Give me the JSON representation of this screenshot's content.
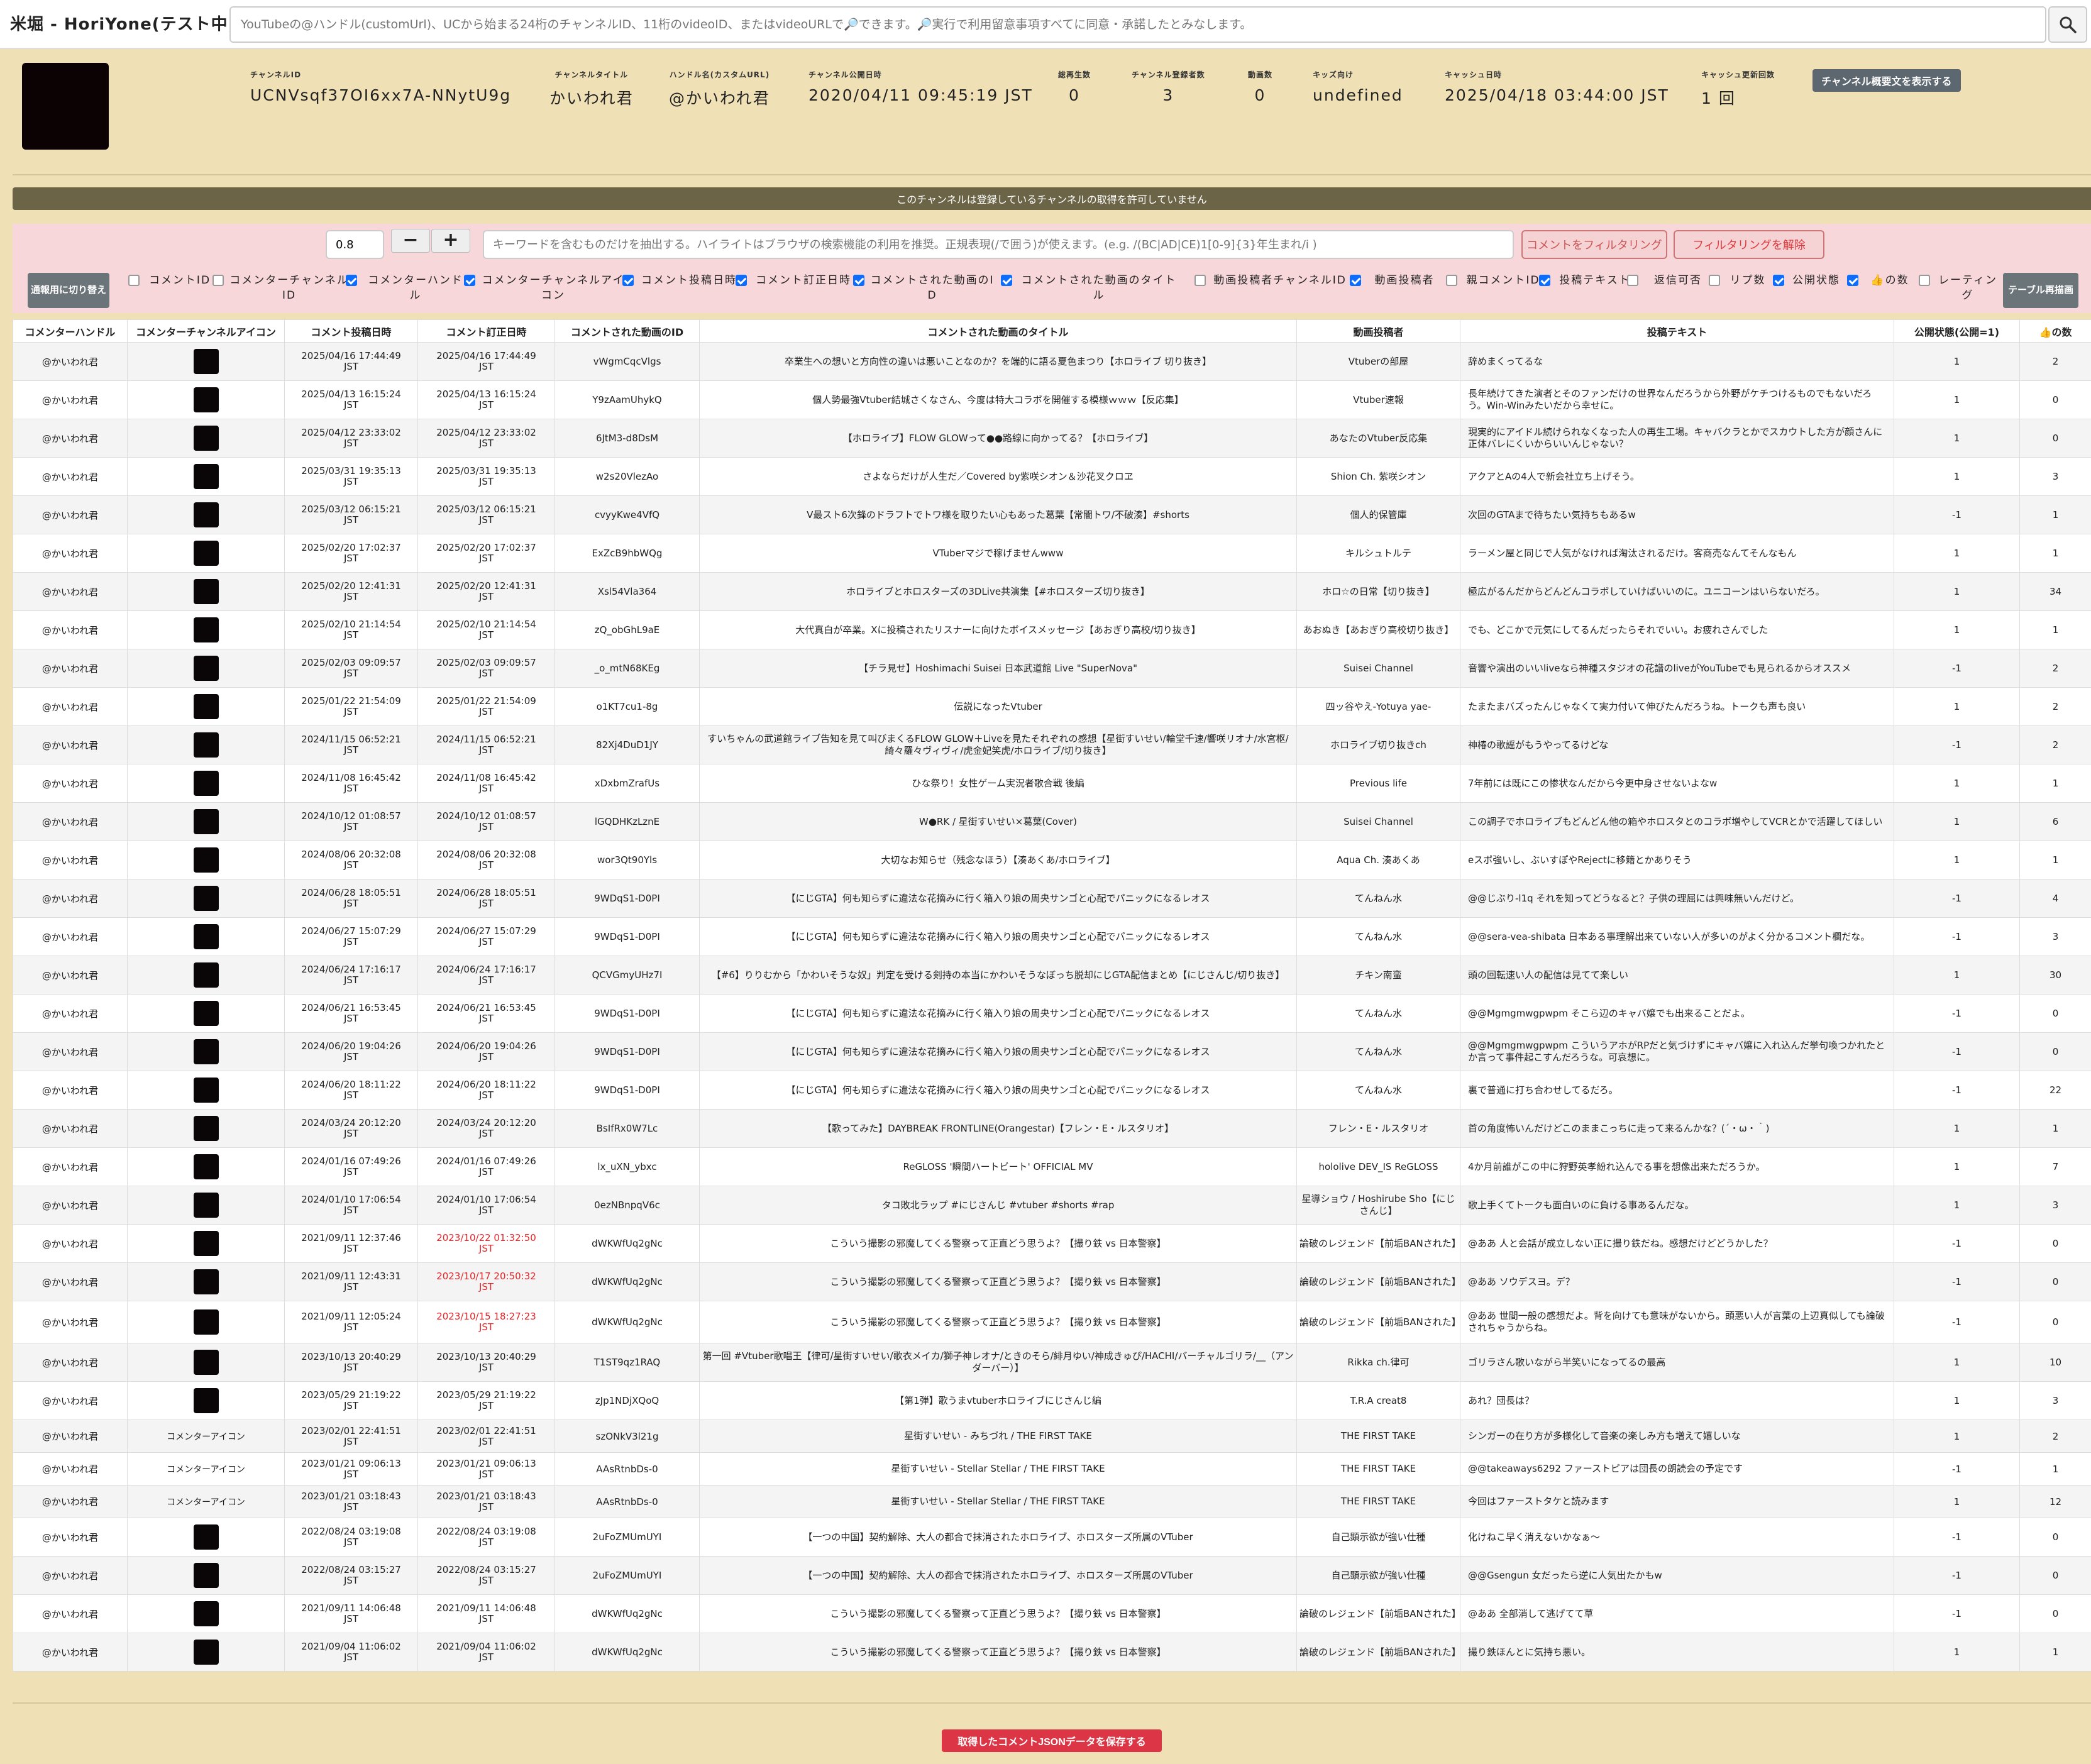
{
  "header": {
    "title": "米堀 - HoriYone(テスト中)",
    "search_placeholder": "YouTubeの@ハンドル(customUrl)、UCから始まる24桁のチャンネルID、11桁のvideoID、またはvideoURLで🔎できます。🔎実行で利用留意事項すべてに同意・承諾したとみなします。",
    "search_icon": "search-icon"
  },
  "channel": {
    "fields": [
      {
        "label": "チャンネルID",
        "value": "UCNVsqf37OI6xx7A-NNytU9g"
      },
      {
        "label": "チャンネルタイトル",
        "value": "かいわれ君"
      },
      {
        "label": "ハンドル名(カスタムURL)",
        "value": "@かいわれ君"
      },
      {
        "label": "チャンネル公開日時",
        "value": "2020/04/11 09:45:19 JST"
      },
      {
        "label": "総再生数",
        "value": "0"
      },
      {
        "label": "チャンネル登録者数",
        "value": "3"
      },
      {
        "label": "動画数",
        "value": "0"
      },
      {
        "label": "キッズ向け",
        "value": "undefined"
      },
      {
        "label": "キャッシュ日時",
        "value": "2025/04/18 03:44:00 JST"
      },
      {
        "label": "キャッシュ更新回数",
        "value": "1 回"
      }
    ],
    "desc_button": "チャンネル概要文を表示する"
  },
  "notice": "このチャンネルは登録しているチャンネルの取得を許可していません",
  "filter": {
    "threshold": "0.8",
    "minus": "−",
    "plus": "+",
    "keyword_placeholder": "キーワードを含むものだけを抽出する。ハイライトはブラウザの検索機能の利用を推奨。正規表現(/で囲う)が使えます。(e.g. /(BC|AD|CE)1[0-9]{3}年生まれ/i )",
    "apply": "コメントをフィルタリング",
    "clear": "フィルタリングを解除",
    "switch": "通報用に切り替え",
    "redraw": "テーブル再描画",
    "toggles": [
      {
        "label": "コメントID",
        "checked": false
      },
      {
        "label": "コメンターチャンネルID",
        "checked": false
      },
      {
        "label": "コメンターハンドル",
        "checked": true
      },
      {
        "label": "コメンターチャンネルアイコン",
        "checked": true
      },
      {
        "label": "コメント投稿日時",
        "checked": true
      },
      {
        "label": "コメント訂正日時",
        "checked": true
      },
      {
        "label": "コメントされた動画のID",
        "checked": true
      },
      {
        "label": "コメントされた動画のタイトル",
        "checked": true
      },
      {
        "label": "動画投稿者チャンネルID",
        "checked": false
      },
      {
        "label": "動画投稿者",
        "checked": true
      },
      {
        "label": "親コメントID",
        "checked": false
      },
      {
        "label": "投稿テキスト",
        "checked": true
      },
      {
        "label": "返信可否",
        "checked": false
      },
      {
        "label": "リプ数",
        "checked": false
      },
      {
        "label": "公開状態",
        "checked": true
      },
      {
        "label": "👍の数",
        "checked": true
      },
      {
        "label": "レーティング",
        "checked": false
      }
    ]
  },
  "table": {
    "headers": [
      "コメンターハンドル",
      "コメンターチャンネルアイコン",
      "コメント投稿日時",
      "コメント訂正日時",
      "コメントされた動画のID",
      "コメントされた動画のタイトル",
      "動画投稿者",
      "投稿テキスト",
      "公開状態(公開=1)",
      "👍の数"
    ],
    "broken_icon_alt": "コメンターアイコン",
    "rows": [
      {
        "h": "@かいわれ君",
        "icon": "img",
        "p": "2025/04/16 17:44:49",
        "e": "2025/04/16 17:44:49",
        "er": false,
        "vid": "vWgmCqcVlgs",
        "title": "卒業生への想いと方向性の違いは悪いことなのか？を端的に語る夏色まつり【ホロライブ 切り抜き】",
        "auth": "Vtuberの部屋",
        "text": "辞めまくってるな",
        "pub": "1",
        "likes": "2",
        "hgt": 61
      },
      {
        "h": "@かいわれ君",
        "icon": "img",
        "p": "2025/04/13 16:15:24",
        "e": "2025/04/13 16:15:24",
        "er": false,
        "vid": "Y9zAamUhykQ",
        "title": "個人勢最強Vtuber結城さくなさん、今度は特大コラボを開催する模様ｗｗｗ【反応集】",
        "auth": "Vtuber速報",
        "text": "長年続けてきた演者とそのファンだけの世界なんだろうから外野がケチつけるものでもないだろう。Win-Winみたいだから幸せに。",
        "pub": "1",
        "likes": "0",
        "hgt": 61
      },
      {
        "h": "@かいわれ君",
        "icon": "img",
        "p": "2025/04/12 23:33:02",
        "e": "2025/04/12 23:33:02",
        "er": false,
        "vid": "6JtM3-d8DsM",
        "title": "【ホロライブ】FLOW GLOWって●●路線に向かってる？【ホロライブ】",
        "auth": "あなたのVtuber反応集",
        "text": "現実的にアイドル続けられなくなった人の再生工場。キャバクラとかでスカウトした方が顔さんに正体バレにくいからいいんじゃない？",
        "pub": "1",
        "likes": "0",
        "hgt": 61
      },
      {
        "h": "@かいわれ君",
        "icon": "img",
        "p": "2025/03/31 19:35:13",
        "e": "2025/03/31 19:35:13",
        "er": false,
        "vid": "w2s20VlezAo",
        "title": "さよならだけが人生だ／Covered by紫咲シオン＆沙花叉クロヱ",
        "auth": "Shion Ch. 紫咲シオン",
        "text": "アクアとAの4人で新会社立ち上げそう。",
        "pub": "1",
        "likes": "3",
        "hgt": 61
      },
      {
        "h": "@かいわれ君",
        "icon": "img",
        "p": "2025/03/12 06:15:21",
        "e": "2025/03/12 06:15:21",
        "er": false,
        "vid": "cvyyKwe4VfQ",
        "title": "V最スト6次鋒のドラフトでトワ様を取りたい心もあった葛葉【常闇トワ/不破湊】#shorts",
        "auth": "個人的保管庫",
        "text": "次回のGTAまで待ちたい気持ちもあるw",
        "pub": "-1",
        "likes": "1",
        "hgt": 61
      },
      {
        "h": "@かいわれ君",
        "icon": "img",
        "p": "2025/02/20 17:02:37",
        "e": "2025/02/20 17:02:37",
        "er": false,
        "vid": "ExZcB9hbWQg",
        "title": "VTuberマジで稼げませんwww",
        "auth": "キルシュトルテ",
        "text": "ラーメン屋と同じで人気がなければ淘汰されるだけ。客商売なんてそんなもん",
        "pub": "1",
        "likes": "1",
        "hgt": 61
      },
      {
        "h": "@かいわれ君",
        "icon": "img",
        "p": "2025/02/20 12:41:31",
        "e": "2025/02/20 12:41:31",
        "er": false,
        "vid": "Xsl54Vla364",
        "title": "ホロライブとホロスターズの3DLive共演集【#ホロスターズ切り抜き】",
        "auth": "ホロ☆の日常【切り抜き】",
        "text": "極広がるんだからどんどんコラボしていけばいいのに。ユニコーンはいらないだろ。",
        "pub": "1",
        "likes": "34",
        "hgt": 61
      },
      {
        "h": "@かいわれ君",
        "icon": "img",
        "p": "2025/02/10 21:14:54",
        "e": "2025/02/10 21:14:54",
        "er": false,
        "vid": "zQ_obGhL9aE",
        "title": "大代真白が卒業。Xに投稿されたリスナーに向けたボイスメッセージ【あおぎり高校/切り抜き】",
        "auth": "あおぬき【あおぎり高校切り抜き】",
        "text": "でも、どこかで元気にしてるんだったらそれでいい。お疲れさんでした",
        "pub": "1",
        "likes": "1",
        "hgt": 61
      },
      {
        "h": "@かいわれ君",
        "icon": "img",
        "p": "2025/02/03 09:09:57",
        "e": "2025/02/03 09:09:57",
        "er": false,
        "vid": "_o_mtN68KEg",
        "title": "【チラ見せ】Hoshimachi Suisei 日本武道館 Live \"SuperNova\"",
        "auth": "Suisei Channel",
        "text": "音響や演出のいいliveなら神種スタジオの花譜のliveがYouTubeでも見られるからオススメ",
        "pub": "-1",
        "likes": "2",
        "hgt": 61
      },
      {
        "h": "@かいわれ君",
        "icon": "img",
        "p": "2025/01/22 21:54:09",
        "e": "2025/01/22 21:54:09",
        "er": false,
        "vid": "o1KT7cu1-8g",
        "title": "伝説になったVtuber",
        "auth": "四ッ谷やえ-Yotuya yae-",
        "text": "たまたまバズったんじゃなくて実力付いて伸びたんだろうね。トークも声も良い",
        "pub": "1",
        "likes": "2",
        "hgt": 61
      },
      {
        "h": "@かいわれ君",
        "icon": "img",
        "p": "2024/11/15 06:52:21",
        "e": "2024/11/15 06:52:21",
        "er": false,
        "vid": "82Xj4DuD1JY",
        "title": "すいちゃんの武道館ライブ告知を見て叫びまくるFLOW GLOW＋Liveを見たそれぞれの感想【星街すいせい/輪堂千速/響咲リオナ/水宮枢/綺々羅々ヴィヴィ/虎金妃笑虎/ホロライブ/切り抜き】",
        "auth": "ホロライブ切り抜きch",
        "text": "神椿の歌謡がもうやってるけどな",
        "pub": "-1",
        "likes": "2",
        "hgt": 61
      },
      {
        "h": "@かいわれ君",
        "icon": "img",
        "p": "2024/11/08 16:45:42",
        "e": "2024/11/08 16:45:42",
        "er": false,
        "vid": "xDxbmZrafUs",
        "title": "ひな祭り！女性ゲーム実況者歌合戦 後編",
        "auth": "Previous life",
        "text": "7年前には既にこの惨状なんだから今更中身させないよなw",
        "pub": "1",
        "likes": "1",
        "hgt": 61
      },
      {
        "h": "@かいわれ君",
        "icon": "img",
        "p": "2024/10/12 01:08:57",
        "e": "2024/10/12 01:08:57",
        "er": false,
        "vid": "lGQDHKzLznE",
        "title": "W●RK / 星街すいせい×葛葉(Cover)",
        "auth": "Suisei Channel",
        "text": "この調子でホロライブもどんどん他の箱やホロスタとのコラボ増やしてVCRとかで活躍してほしい",
        "pub": "1",
        "likes": "6",
        "hgt": 61
      },
      {
        "h": "@かいわれ君",
        "icon": "img",
        "p": "2024/08/06 20:32:08",
        "e": "2024/08/06 20:32:08",
        "er": false,
        "vid": "wor3Qt90Yls",
        "title": "大切なお知らせ（残念なほう）【湊あくあ/ホロライブ】",
        "auth": "Aqua Ch. 湊あくあ",
        "text": "eスポ強いし、ぶいすぽやRejectに移籍とかありそう",
        "pub": "1",
        "likes": "1",
        "hgt": 61
      },
      {
        "h": "@かいわれ君",
        "icon": "img",
        "p": "2024/06/28 18:05:51",
        "e": "2024/06/28 18:05:51",
        "er": false,
        "vid": "9WDqS1-D0PI",
        "title": "【にじGTA】何も知らずに違法な花摘みに行く箱入り娘の周央サンゴと心配でパニックになるレオス",
        "auth": "てんねん水",
        "text": "@@じぶり-l1q それを知ってどうなると？子供の理屈には興味無いんだけど。",
        "pub": "-1",
        "likes": "4",
        "hgt": 61
      },
      {
        "h": "@かいわれ君",
        "icon": "img",
        "p": "2024/06/27 15:07:29",
        "e": "2024/06/27 15:07:29",
        "er": false,
        "vid": "9WDqS1-D0PI",
        "title": "【にじGTA】何も知らずに違法な花摘みに行く箱入り娘の周央サンゴと心配でパニックになるレオス",
        "auth": "てんねん水",
        "text": "@@sera-vea-shibata 日本ある事理解出来ていない人が多いのがよく分かるコメント欄だな。",
        "pub": "-1",
        "likes": "3",
        "hgt": 61
      },
      {
        "h": "@かいわれ君",
        "icon": "img",
        "p": "2024/06/24 17:16:17",
        "e": "2024/06/24 17:16:17",
        "er": false,
        "vid": "QCVGmyUHz7I",
        "title": "【#6】りりむから「かわいそうな奴」判定を受ける剣持の本当にかわいそうなぼっち脱却にじGTA配信まとめ【にじさんじ/切り抜き】",
        "auth": "チキン南蛮",
        "text": "頭の回転速い人の配信は見てて楽しい",
        "pub": "1",
        "likes": "30",
        "hgt": 61
      },
      {
        "h": "@かいわれ君",
        "icon": "img",
        "p": "2024/06/21 16:53:45",
        "e": "2024/06/21 16:53:45",
        "er": false,
        "vid": "9WDqS1-D0PI",
        "title": "【にじGTA】何も知らずに違法な花摘みに行く箱入り娘の周央サンゴと心配でパニックになるレオス",
        "auth": "てんねん水",
        "text": "@@Mgmgmwgpwpm そこら辺のキャバ嬢でも出来ることだよ。",
        "pub": "-1",
        "likes": "0",
        "hgt": 61
      },
      {
        "h": "@かいわれ君",
        "icon": "img",
        "p": "2024/06/20 19:04:26",
        "e": "2024/06/20 19:04:26",
        "er": false,
        "vid": "9WDqS1-D0PI",
        "title": "【にじGTA】何も知らずに違法な花摘みに行く箱入り娘の周央サンゴと心配でパニックになるレオス",
        "auth": "てんねん水",
        "text": "@@Mgmgmwgpwpm こういうアホがRPだと気づけずにキャバ嬢に入れ込んだ挙句喚つかれたとか言って事件起こすんだろうな。可哀想に。",
        "pub": "-1",
        "likes": "0",
        "hgt": 61
      },
      {
        "h": "@かいわれ君",
        "icon": "img",
        "p": "2024/06/20 18:11:22",
        "e": "2024/06/20 18:11:22",
        "er": false,
        "vid": "9WDqS1-D0PI",
        "title": "【にじGTA】何も知らずに違法な花摘みに行く箱入り娘の周央サンゴと心配でパニックになるレオス",
        "auth": "てんねん水",
        "text": "裏で普通に打ち合わせしてるだろ。",
        "pub": "-1",
        "likes": "22",
        "hgt": 61
      },
      {
        "h": "@かいわれ君",
        "icon": "img",
        "p": "2024/03/24 20:12:20",
        "e": "2024/03/24 20:12:20",
        "er": false,
        "vid": "BsIfRx0W7Lc",
        "title": "【歌ってみた】DAYBREAK FRONTLINE(Orangestar)【フレン・E・ルスタリオ】",
        "auth": "フレン・E・ルスタリオ",
        "text": "首の角度怖いんだけどこのままこっちに走って来るんかな？(´・ω・｀)",
        "pub": "1",
        "likes": "1",
        "hgt": 61
      },
      {
        "h": "@かいわれ君",
        "icon": "img",
        "p": "2024/01/16 07:49:26",
        "e": "2024/01/16 07:49:26",
        "er": false,
        "vid": "lx_uXN_ybxc",
        "title": "ReGLOSS '瞬間ハートビート' OFFICIAL MV",
        "auth": "hololive DEV_IS ReGLOSS",
        "text": "4か月前誰がこの中に狩野英孝紛れ込んでる事を想像出来ただろうか。",
        "pub": "1",
        "likes": "7",
        "hgt": 61
      },
      {
        "h": "@かいわれ君",
        "icon": "img",
        "p": "2024/01/10 17:06:54",
        "e": "2024/01/10 17:06:54",
        "er": false,
        "vid": "0ezNBnpqV6c",
        "title": "タコ敗北ラップ #にじさんじ #vtuber #shorts #rap",
        "auth": "星導ショウ / Hoshirube Sho【にじさんじ】",
        "text": "歌上手くてトークも面白いのに負ける事あるんだな。",
        "pub": "1",
        "likes": "3",
        "hgt": 61
      },
      {
        "h": "@かいわれ君",
        "icon": "img",
        "p": "2021/09/11 12:37:46",
        "e": "2023/10/22 01:32:50",
        "er": true,
        "vid": "dWKWfUq2gNc",
        "title": "こういう撮影の邪魔してくる警察って正直どう思うよ？【撮り鉄 vs 日本警察】",
        "auth": "論破のレジェンド【前垢BANされた】",
        "text": "@ああ 人と会話が成立しない正に撮り鉄だね。感想だけどどうかした？",
        "pub": "-1",
        "likes": "0",
        "hgt": 61
      },
      {
        "h": "@かいわれ君",
        "icon": "img",
        "p": "2021/09/11 12:43:31",
        "e": "2023/10/17 20:50:32",
        "er": true,
        "vid": "dWKWfUq2gNc",
        "title": "こういう撮影の邪魔してくる警察って正直どう思うよ？【撮り鉄 vs 日本警察】",
        "auth": "論破のレジェンド【前垢BANされた】",
        "text": "@ああ ソウデスヨ。デ？",
        "pub": "-1",
        "likes": "0",
        "hgt": 61
      },
      {
        "h": "@かいわれ君",
        "icon": "img",
        "p": "2021/09/11 12:05:24",
        "e": "2023/10/15 18:27:23",
        "er": true,
        "vid": "dWKWfUq2gNc",
        "title": "こういう撮影の邪魔してくる警察って正直どう思うよ？【撮り鉄 vs 日本警察】",
        "auth": "論破のレジェンド【前垢BANされた】",
        "text": "@ああ 世間一般の感想だよ。背を向けても意味がないから。頭悪い人が言葉の上辺真似しても論破されちゃうからね。",
        "pub": "-1",
        "likes": "0",
        "hgt": 67
      },
      {
        "h": "@かいわれ君",
        "icon": "img",
        "p": "2023/10/13 20:40:29",
        "e": "2023/10/13 20:40:29",
        "er": false,
        "vid": "T1ST9qz1RAQ",
        "title": "第一回 #Vtuber歌唱王【律可/星街すいせい/歌衣メイカ/獅子神レオナ/ときのそら/緋月ゆい/神成きゅぴ/HACHI/バーチャルゴリラ/__（アンダーバー）】",
        "auth": "Rikka ch.律可",
        "text": "ゴリラさん歌いながら半笑いになってるの最高",
        "pub": "1",
        "likes": "10",
        "hgt": 61
      },
      {
        "h": "@かいわれ君",
        "icon": "img",
        "p": "2023/05/29 21:19:22",
        "e": "2023/05/29 21:19:22",
        "er": false,
        "vid": "zJp1NDjXQoQ",
        "title": "【第1弾】歌うまvtuberホロライブにじさんじ編",
        "auth": "T.R.A creat8",
        "text": "あれ？団長は？",
        "pub": "1",
        "likes": "3",
        "hgt": 61
      },
      {
        "h": "@かいわれ君",
        "icon": "broken",
        "p": "2023/02/01 22:41:51",
        "e": "2023/02/01 22:41:51",
        "er": false,
        "vid": "szONkV3l21g",
        "title": "星街すいせい - みちづれ / THE FIRST TAKE",
        "auth": "THE FIRST TAKE",
        "text": "シンガーの在り方が多様化して音楽の楽しみ方も増えて嬉しいな",
        "pub": "1",
        "likes": "2",
        "hgt": 52
      },
      {
        "h": "@かいわれ君",
        "icon": "broken",
        "p": "2023/01/21 09:06:13",
        "e": "2023/01/21 09:06:13",
        "er": false,
        "vid": "AAsRtnbDs-0",
        "title": "星街すいせい - Stellar Stellar / THE FIRST TAKE",
        "auth": "THE FIRST TAKE",
        "text": "@@takeaways6292 ファーストピアは団長の朗読会の予定です",
        "pub": "-1",
        "likes": "1",
        "hgt": 52
      },
      {
        "h": "@かいわれ君",
        "icon": "broken",
        "p": "2023/01/21 03:18:43",
        "e": "2023/01/21 03:18:43",
        "er": false,
        "vid": "AAsRtnbDs-0",
        "title": "星街すいせい - Stellar Stellar / THE FIRST TAKE",
        "auth": "THE FIRST TAKE",
        "text": "今回はファーストタケと読みます",
        "pub": "1",
        "likes": "12",
        "hgt": 52
      },
      {
        "h": "@かいわれ君",
        "icon": "img",
        "p": "2022/08/24 03:19:08",
        "e": "2022/08/24 03:19:08",
        "er": false,
        "vid": "2uFoZMUmUYI",
        "title": "【一つの中国】契約解除、大人の都合で抹消されたホロライブ、ホロスターズ所属のVTuber",
        "auth": "自己顕示欲が強い仕種",
        "text": "化けねこ早く消えないかなぁ〜",
        "pub": "-1",
        "likes": "0",
        "hgt": 61
      },
      {
        "h": "@かいわれ君",
        "icon": "img",
        "p": "2022/08/24 03:15:27",
        "e": "2022/08/24 03:15:27",
        "er": false,
        "vid": "2uFoZMUmUYI",
        "title": "【一つの中国】契約解除、大人の都合で抹消されたホロライブ、ホロスターズ所属のVTuber",
        "auth": "自己顕示欲が強い仕種",
        "text": "@@Gsengun 女だったら逆に人気出たかもw",
        "pub": "-1",
        "likes": "0",
        "hgt": 61
      },
      {
        "h": "@かいわれ君",
        "icon": "img",
        "p": "2021/09/11 14:06:48",
        "e": "2021/09/11 14:06:48",
        "er": false,
        "vid": "dWKWfUq2gNc",
        "title": "こういう撮影の邪魔してくる警察って正直どう思うよ？【撮り鉄 vs 日本警察】",
        "auth": "論破のレジェンド【前垢BANされた】",
        "text": "@ああ 全部消して逃げてて草",
        "pub": "-1",
        "likes": "0",
        "hgt": 61
      },
      {
        "h": "@かいわれ君",
        "icon": "img",
        "p": "2021/09/04 11:06:02",
        "e": "2021/09/04 11:06:02",
        "er": false,
        "vid": "dWKWfUq2gNc",
        "title": "こういう撮影の邪魔してくる警察って正直どう思うよ？【撮り鉄 vs 日本警察】",
        "auth": "論破のレジェンド【前垢BANされた】",
        "text": "撮り鉄ほんとに気持ち悪い。",
        "pub": "1",
        "likes": "1",
        "hgt": 61
      }
    ]
  },
  "jst": "JST",
  "save_button": "取得したコメントJSONデータを保存する",
  "colors": {
    "page_bg": "#efe0b6",
    "notice_bg": "#6b6447",
    "filter_bg": "#f8d7da",
    "save_btn": "#dc3545",
    "edited_date": "#e2262a",
    "checkbox_on": "#0d6efd"
  }
}
